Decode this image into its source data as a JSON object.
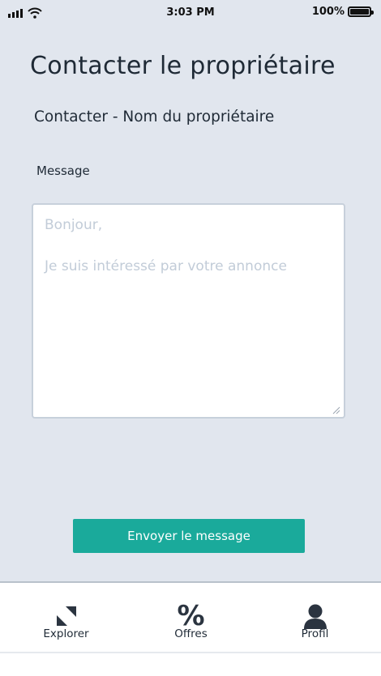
{
  "status_bar": {
    "time": "3:03 PM",
    "battery": "100%"
  },
  "page": {
    "title": "Contacter le propriétaire",
    "subtitle": "Contacter - Nom du propriétaire"
  },
  "form": {
    "message_label": "Message",
    "message_value": "",
    "message_placeholder": "Bonjour,\n\nJe suis intéressé par votre annonce",
    "send_label": "Envoyer le message"
  },
  "tabs": [
    {
      "label": "Explorer",
      "icon": "explore-icon"
    },
    {
      "label": "Offres",
      "icon": "percent-icon"
    },
    {
      "label": "Profil",
      "icon": "person-icon"
    }
  ],
  "colors": {
    "background": "#e1e6ee",
    "accent": "#1aaa9b"
  }
}
